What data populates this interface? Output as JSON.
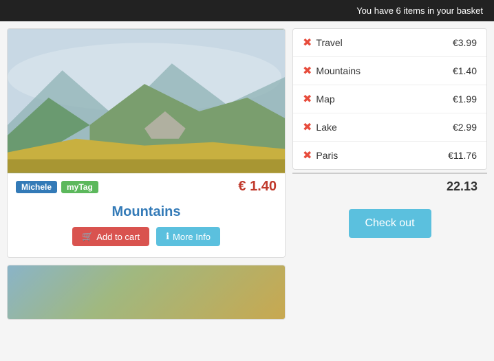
{
  "topBar": {
    "message": "You have 6 items in your basket"
  },
  "product": {
    "title": "Mountains",
    "price": "€ 1.40",
    "tags": [
      {
        "label": "Michele",
        "color": "blue"
      },
      {
        "label": "myTag",
        "color": "green"
      }
    ],
    "addToCartLabel": "Add to cart",
    "moreInfoLabel": "More Info"
  },
  "basket": {
    "items": [
      {
        "name": "Travel",
        "price": "€3.99"
      },
      {
        "name": "Mountains",
        "price": "€1.40"
      },
      {
        "name": "Map",
        "price": "€1.99"
      },
      {
        "name": "Lake",
        "price": "€2.99"
      },
      {
        "name": "Paris",
        "price": "€11.76"
      }
    ],
    "total": "22.13",
    "checkoutLabel": "Check out"
  }
}
